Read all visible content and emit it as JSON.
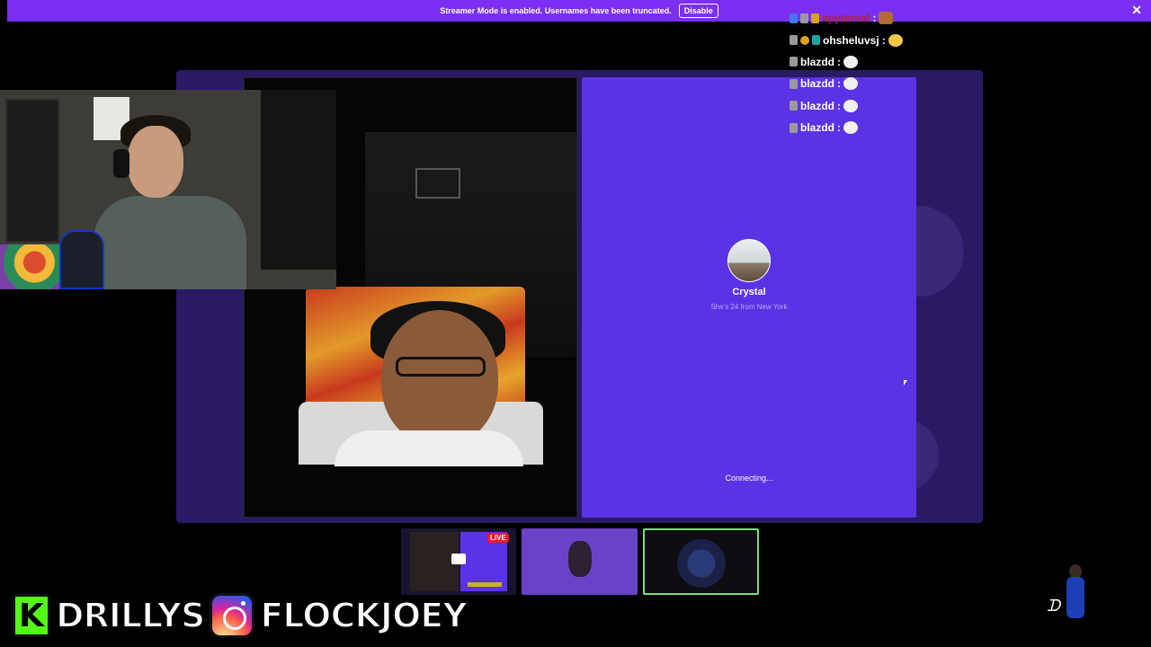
{
  "banner": {
    "text": "Streamer Mode is enabled. Usernames have been truncated.",
    "button_label": "Disable",
    "close_glyph": "✕"
  },
  "profile": {
    "name": "Crystal",
    "subtitle": "She's 24 from New York",
    "status": "Connecting..."
  },
  "chat": {
    "messages": [
      {
        "user": "spyteroal",
        "sep": ":",
        "emote": "face-emote"
      },
      {
        "user": "ohsheluvsj",
        "sep": ":",
        "emote": "thinking-emote"
      },
      {
        "user": "blazdd",
        "sep": ":",
        "emote": "white-emote"
      },
      {
        "user": "blazdd",
        "sep": ":",
        "emote": "white-emote"
      },
      {
        "user": "blazdd",
        "sep": ":",
        "emote": "white-emote"
      },
      {
        "user": "blazdd",
        "sep": ":",
        "emote": "white-emote"
      }
    ]
  },
  "thumbnails": {
    "live_badge": "LIVE"
  },
  "socials": {
    "kick_glyph": "K",
    "kick_handle": "DRILLYS",
    "instagram_handle": "FLOCKJOEY"
  },
  "mascot": {
    "signature": "ᗪ"
  },
  "colors": {
    "accent": "#7b2ff2",
    "call_panel": "#5b33e6",
    "stage": "#2a1a63",
    "kick_green": "#53fc18",
    "live_red": "#e51c2a"
  }
}
